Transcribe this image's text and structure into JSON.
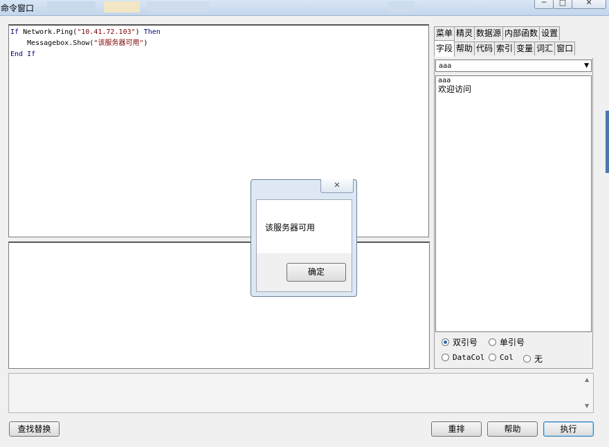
{
  "window": {
    "title": "命令窗口",
    "buttons": {
      "minimize": "─",
      "maximize": "□",
      "close": "✕"
    }
  },
  "editor": {
    "lines": [
      {
        "kw1": "If ",
        "text1": "Network.Ping(",
        "str1": "\"10.41.72.103\"",
        "text2": ") ",
        "kw2": "Then"
      },
      {
        "kw1": "",
        "text1": "    Messagebox.Show(",
        "str1": "\"该服务器可用\"",
        "text2": ")",
        "kw2": ""
      },
      {
        "kw1": "End If",
        "text1": "",
        "str1": "",
        "text2": "",
        "kw2": ""
      }
    ]
  },
  "tabs": {
    "row1": [
      "菜单",
      "精灵",
      "数据源",
      "内部函数",
      "设置"
    ],
    "row2": [
      "字段",
      "帮助",
      "代码",
      "索引",
      "变量",
      "词汇",
      "窗口"
    ],
    "active": "字段"
  },
  "field_panel": {
    "table_select": "aaa",
    "list": [
      "aaa",
      "欢迎访问"
    ],
    "quote_options": [
      "双引号",
      "单引号",
      "DataCol",
      "Col",
      "无"
    ],
    "selected_option": "双引号"
  },
  "buttons": {
    "find_replace": "查找替换",
    "reformat": "重排",
    "help": "帮助",
    "execute": "执行"
  },
  "dialog": {
    "close": "✕",
    "message": "该服务器可用",
    "ok": "确定"
  },
  "icons": {
    "combo_arrow": "▼",
    "scroll_up": "▲",
    "scroll_down": "▼"
  },
  "colors": {
    "keyword": "#00007f",
    "string": "#7f0000",
    "radio_selected": "#2b6fb6"
  }
}
